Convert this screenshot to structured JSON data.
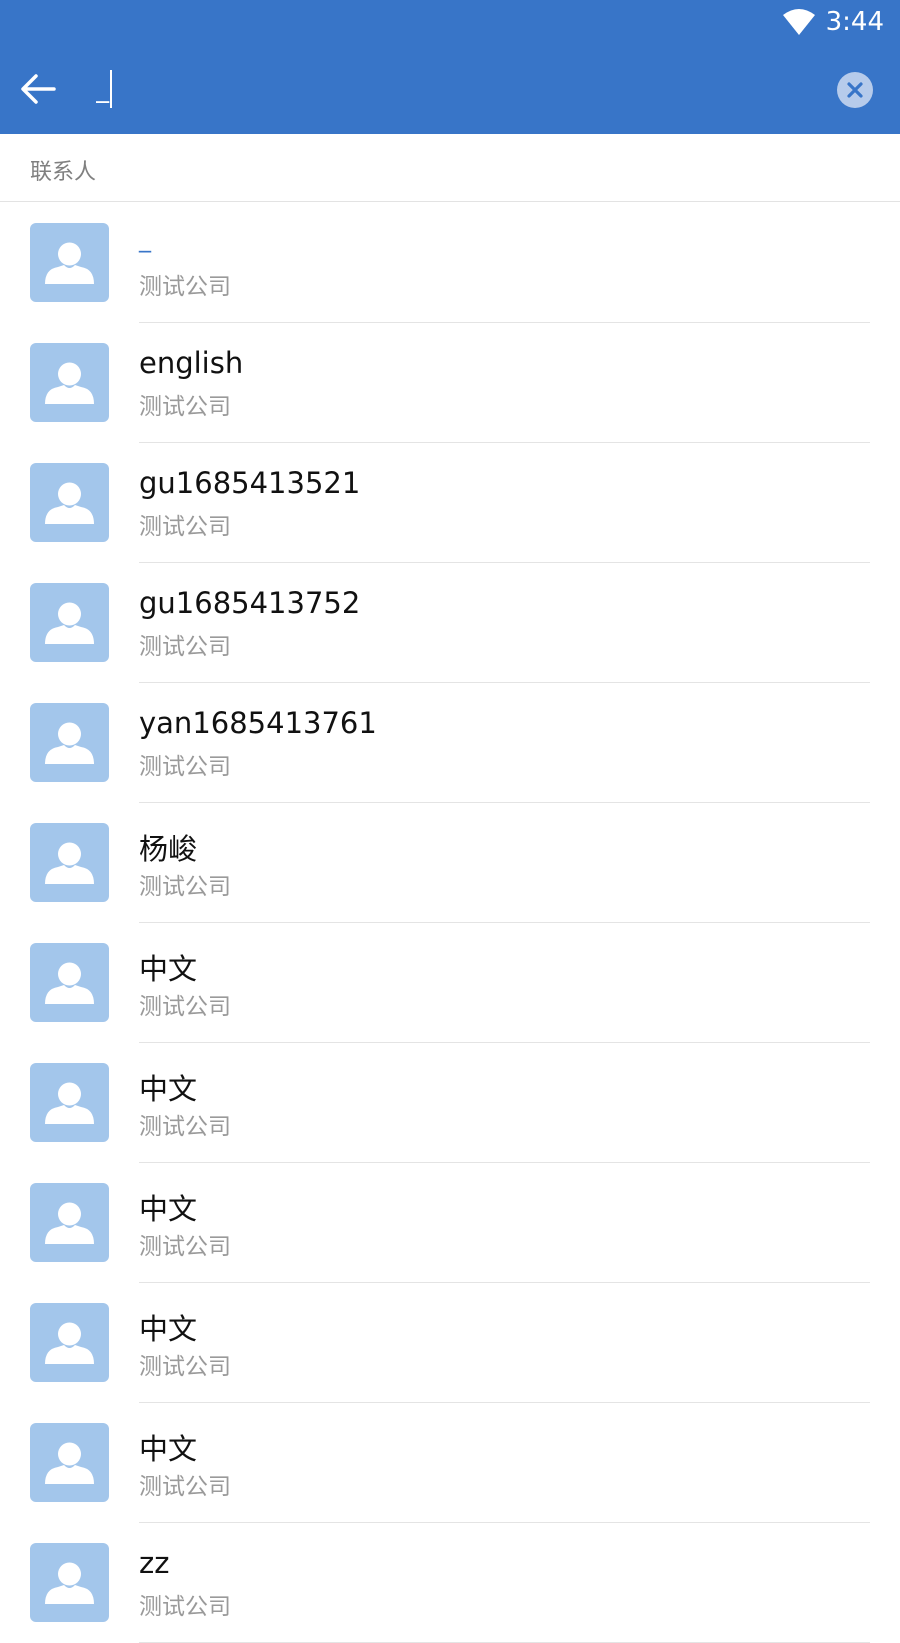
{
  "status_bar": {
    "time": "3:44"
  },
  "search": {
    "value": "_",
    "placeholder": ""
  },
  "section": {
    "title": "联系人"
  },
  "contacts": [
    {
      "name": "_",
      "company": "测试公司"
    },
    {
      "name": "english",
      "company": "测试公司"
    },
    {
      "name": "gu1685413521",
      "company": "测试公司"
    },
    {
      "name": "gu1685413752",
      "company": "测试公司"
    },
    {
      "name": "yan1685413761",
      "company": "测试公司"
    },
    {
      "name": "杨峻",
      "company": "测试公司"
    },
    {
      "name": "中文",
      "company": "测试公司"
    },
    {
      "name": "中文",
      "company": "测试公司"
    },
    {
      "name": "中文",
      "company": "测试公司"
    },
    {
      "name": "中文",
      "company": "测试公司"
    },
    {
      "name": "中文",
      "company": "测试公司"
    },
    {
      "name": "zz",
      "company": "测试公司"
    }
  ],
  "colors": {
    "primary": "#3875c8",
    "avatar_bg": "#a3c6eb",
    "clear_button_bg": "#b6cbeb"
  },
  "icons": {
    "status": "wifi-icon",
    "back": "back-arrow-icon",
    "clear": "clear-icon",
    "avatar": "person-icon"
  }
}
